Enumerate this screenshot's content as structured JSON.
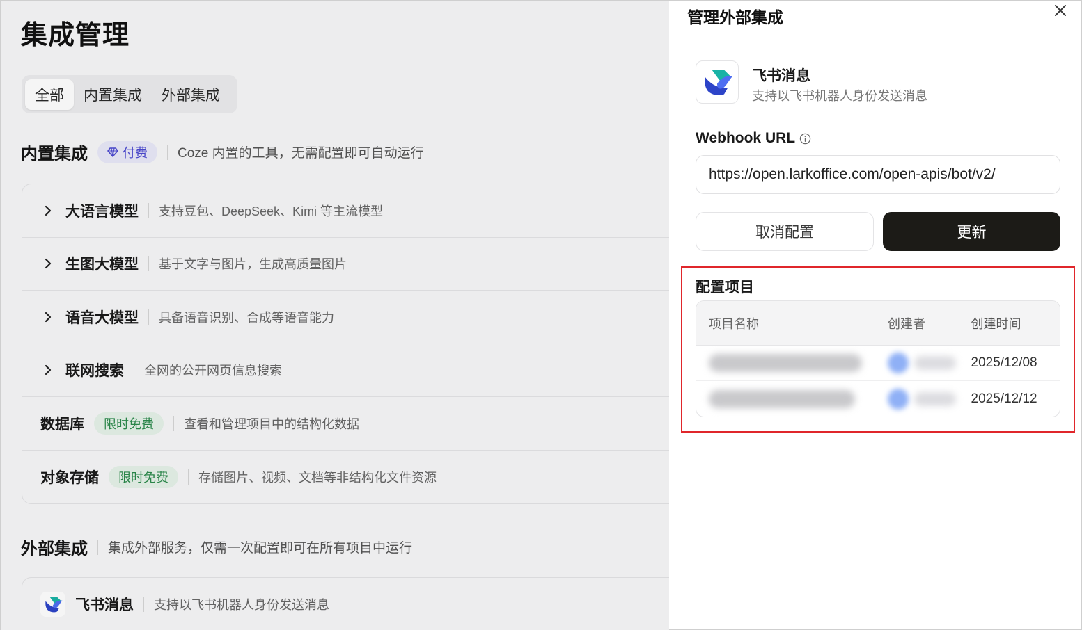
{
  "page": {
    "title": "集成管理",
    "tabs": [
      "全部",
      "内置集成",
      "外部集成"
    ],
    "builtin": {
      "title": "内置集成",
      "badge": "付费",
      "desc": "Coze 内置的工具，无需配置即可自动运行",
      "items": [
        {
          "title": "大语言模型",
          "desc": "支持豆包、DeepSeek、Kimi 等主流模型"
        },
        {
          "title": "生图大模型",
          "desc": "基于文字与图片，生成高质量图片"
        },
        {
          "title": "语音大模型",
          "desc": "具备语音识别、合成等语音能力"
        },
        {
          "title": "联网搜索",
          "desc": "全网的公开网页信息搜索"
        },
        {
          "title": "数据库",
          "badge": "限时免费",
          "desc": "查看和管理项目中的结构化数据"
        },
        {
          "title": "对象存储",
          "badge": "限时免费",
          "desc": "存储图片、视频、文档等非结构化文件资源"
        }
      ]
    },
    "external": {
      "title": "外部集成",
      "desc": "集成外部服务，仅需一次配置即可在所有项目中运行",
      "items": [
        {
          "title": "飞书消息",
          "desc": "支持以飞书机器人身份发送消息"
        }
      ]
    }
  },
  "drawer": {
    "title": "管理外部集成",
    "integration": {
      "name": "飞书消息",
      "desc": "支持以飞书机器人身份发送消息"
    },
    "webhook": {
      "label": "Webhook URL",
      "value": "https://open.larkoffice.com/open-apis/bot/v2/"
    },
    "buttons": {
      "cancel": "取消配置",
      "update": "更新"
    },
    "projects": {
      "title": "配置项目",
      "columns": [
        "项目名称",
        "创建者",
        "创建时间"
      ],
      "rows": [
        {
          "created": "2025/12/08"
        },
        {
          "created": "2025/12/12"
        }
      ]
    }
  },
  "colors": {
    "primary_button": "#1c1b17",
    "highlight": "#e0262b",
    "paid_badge": "#4d4ad1",
    "free_badge": "#2b8a4b"
  }
}
